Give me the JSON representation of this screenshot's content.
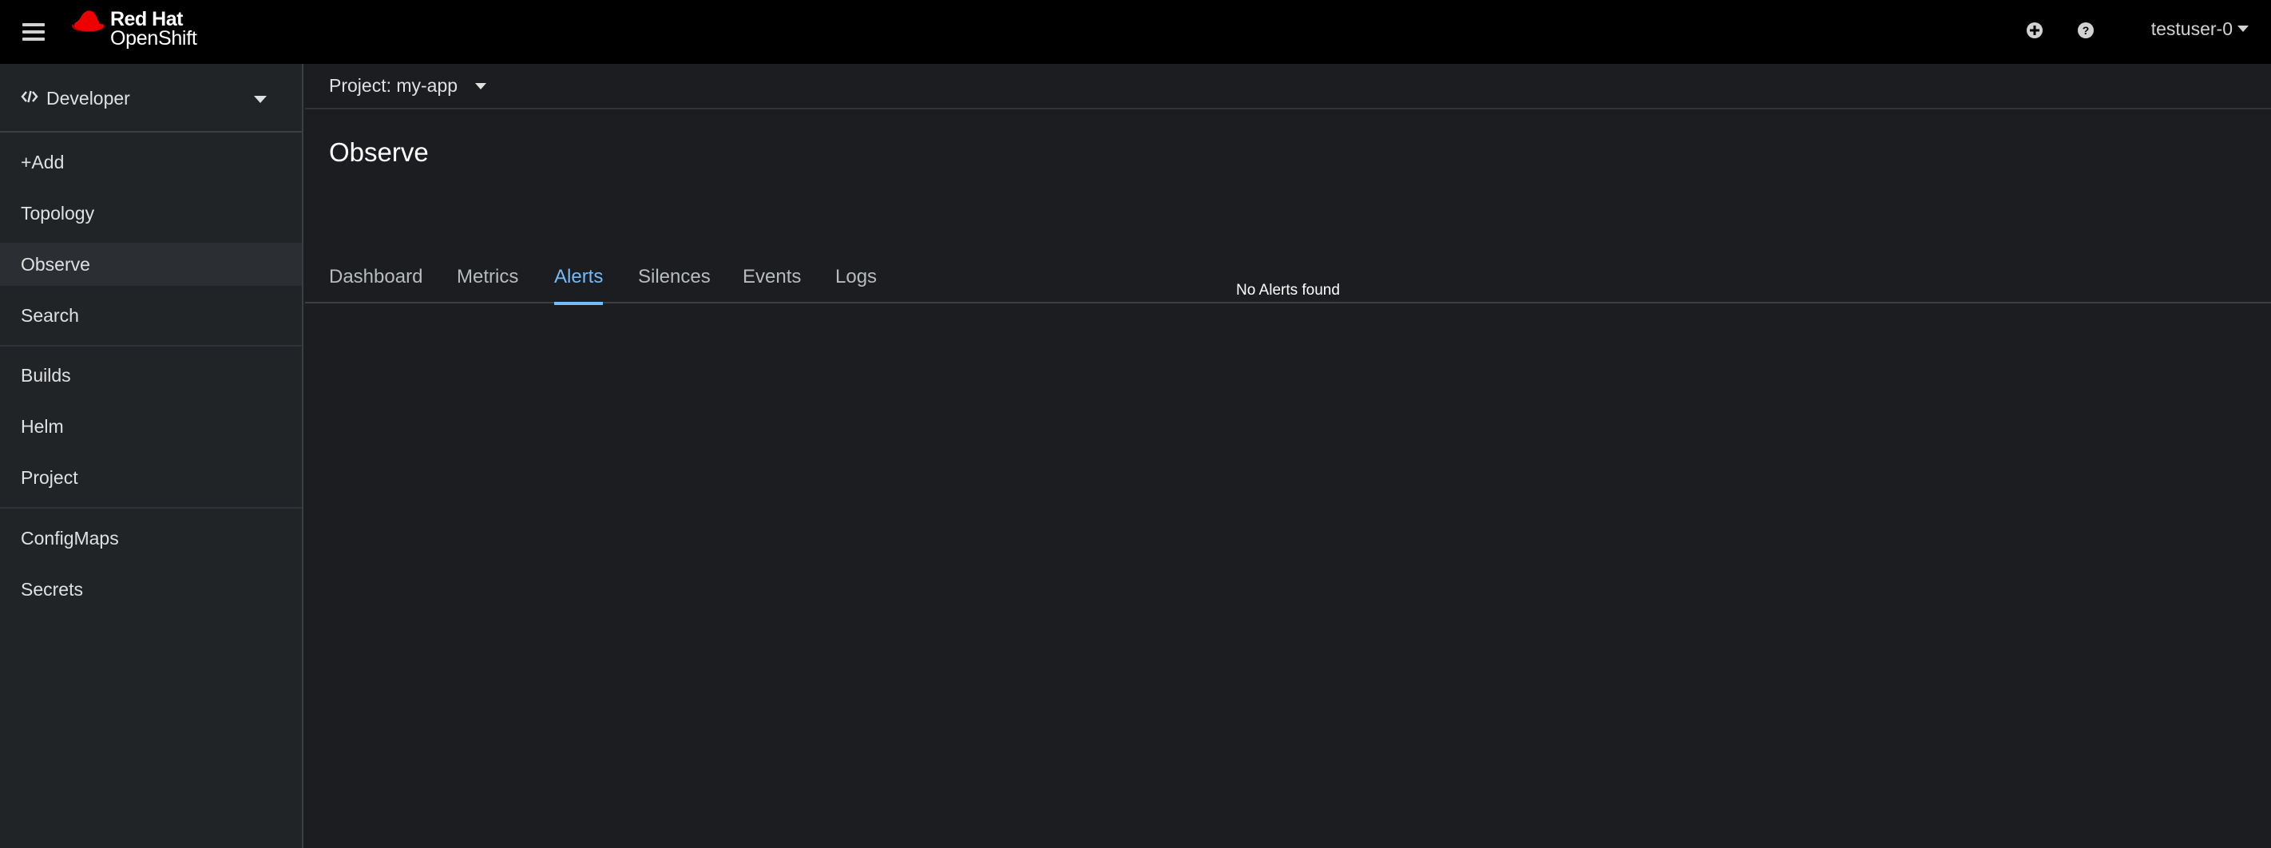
{
  "masthead": {
    "brand_line1": "Red Hat",
    "brand_line2": "OpenShift",
    "user": "testuser-0",
    "icons": {
      "menu": "hamburger-icon",
      "add": "plus-circle-icon",
      "help": "question-circle-icon",
      "logo": "red-hat-fedora-logo"
    },
    "brand_color": "#ee0000"
  },
  "sidebar": {
    "perspective": "Developer",
    "items": [
      {
        "label": "+Add"
      },
      {
        "label": "Topology"
      },
      {
        "label": "Observe",
        "active": true
      },
      {
        "label": "Search"
      },
      {
        "label": "Builds"
      },
      {
        "label": "Helm"
      },
      {
        "label": "Project"
      },
      {
        "label": "ConfigMaps"
      },
      {
        "label": "Secrets"
      }
    ]
  },
  "main": {
    "project_label": "Project: my-app",
    "title": "Observe",
    "tabs": [
      {
        "label": "Dashboard"
      },
      {
        "label": "Metrics"
      },
      {
        "label": "Alerts",
        "active": true
      },
      {
        "label": "Silences"
      },
      {
        "label": "Events"
      },
      {
        "label": "Logs"
      }
    ],
    "empty_message": "No Alerts found",
    "accent_color": "#73bcf7"
  }
}
